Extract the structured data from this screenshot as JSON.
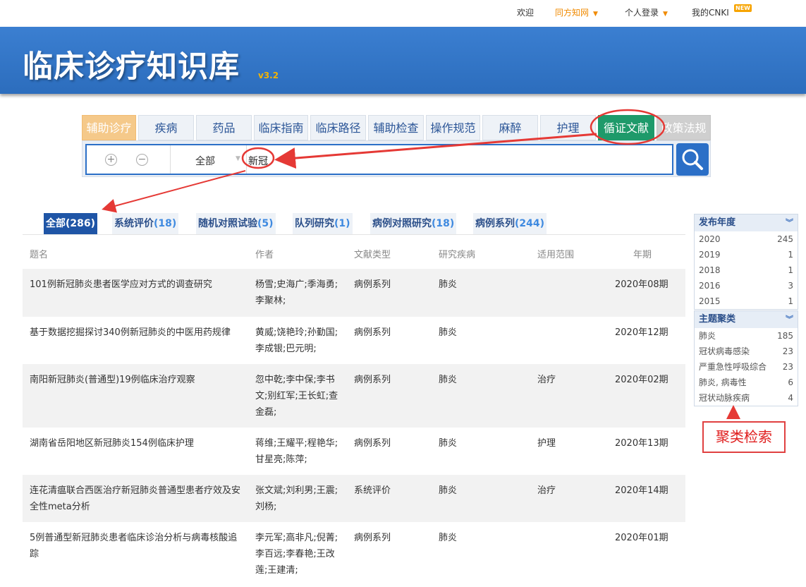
{
  "topnav": {
    "welcome": "欢迎",
    "tongfang": "同方知网",
    "login": "个人登录",
    "mycnki": "我的CNKI",
    "new_badge": "NEW"
  },
  "banner": {
    "title": "临床诊疗知识库",
    "version": "v3.2"
  },
  "tabs": [
    "辅助诊疗",
    "疾病",
    "药品",
    "临床指南",
    "临床路径",
    "辅助检查",
    "操作规范",
    "麻醉",
    "护理",
    "循证文献",
    "政策法规"
  ],
  "search": {
    "scope": "全部",
    "query": "新冠",
    "plus": "+",
    "minus": "−"
  },
  "filters": [
    {
      "label": "全部",
      "count": "(286)"
    },
    {
      "label": "系统评价",
      "count": "(18)"
    },
    {
      "label": "随机对照试验",
      "count": "(5)"
    },
    {
      "label": "队列研究",
      "count": "(1)"
    },
    {
      "label": "病例对照研究",
      "count": "(18)"
    },
    {
      "label": "病例系列",
      "count": "(244)"
    }
  ],
  "table": {
    "headers": [
      "题名",
      "作者",
      "文献类型",
      "研究疾病",
      "适用范围",
      "年期"
    ],
    "rows": [
      {
        "title": "101例新冠肺炎患者医学应对方式的调查研究",
        "author": "杨雪;史海广;季海勇;李聚林;",
        "type": "病例系列",
        "disease": "肺炎",
        "scope": "",
        "year": "2020年08期"
      },
      {
        "title": "基于数据挖掘探讨340例新冠肺炎的中医用药规律",
        "author": "黄威;饶艳玲;孙勤国;李成银;巴元明;",
        "type": "病例系列",
        "disease": "肺炎",
        "scope": "",
        "year": "2020年12期"
      },
      {
        "title": "南阳新冠肺炎(普通型)19例临床治疗观察",
        "author": "忽中乾;李中保;李书文;别红军;王长虹;查金磊;",
        "type": "病例系列",
        "disease": "肺炎",
        "scope": "治疗",
        "year": "2020年02期"
      },
      {
        "title": "湖南省岳阳地区新冠肺炎154例临床护理",
        "author": "蒋维;王耀平;程艳华;甘星亮;陈萍;",
        "type": "病例系列",
        "disease": "肺炎",
        "scope": "护理",
        "year": "2020年13期"
      },
      {
        "title": "连花清瘟联合西医治疗新冠肺炎普通型患者疗效及安全性meta分析",
        "author": "张文斌;刘利男;王震;刘杨;",
        "type": "系统评价",
        "disease": "肺炎",
        "scope": "治疗",
        "year": "2020年14期"
      },
      {
        "title": "5例普通型新冠肺炎患者临床诊治分析与病毒核酸追踪",
        "author": "李元军;高非凡;倪菁;李百远;李春艳;王改莲;王建清;",
        "type": "病例系列",
        "disease": "肺炎",
        "scope": "",
        "year": "2020年01期"
      }
    ]
  },
  "facets": {
    "year": {
      "title": "发布年度",
      "items": [
        {
          "label": "2020",
          "count": "245"
        },
        {
          "label": "2019",
          "count": "1"
        },
        {
          "label": "2018",
          "count": "1"
        },
        {
          "label": "2016",
          "count": "3"
        },
        {
          "label": "2015",
          "count": "1"
        }
      ]
    },
    "topic": {
      "title": "主题聚类",
      "items": [
        {
          "label": "肺炎",
          "count": "185"
        },
        {
          "label": "冠状病毒感染",
          "count": "23"
        },
        {
          "label": "严重急性呼吸综合",
          "count": "23"
        },
        {
          "label": "肺炎, 病毒性",
          "count": "6"
        },
        {
          "label": "冠状动脉疾病",
          "count": "4"
        }
      ]
    }
  },
  "annotation": {
    "cluster_note": "聚类检索"
  },
  "colors": {
    "brand_blue": "#2b6fc7",
    "active_tab": "#1e9a6a",
    "highlight_red": "#e02020"
  }
}
